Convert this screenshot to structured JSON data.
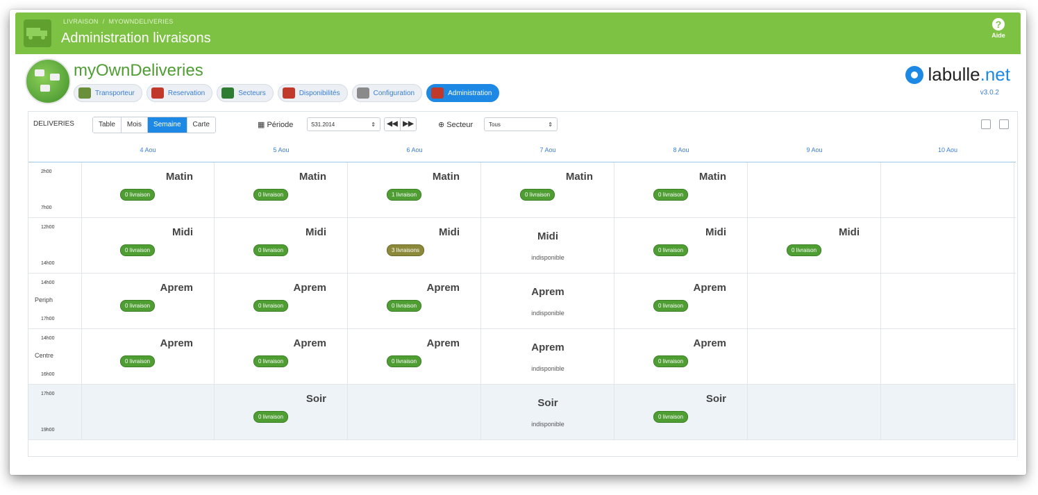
{
  "header": {
    "breadcrumb": [
      "LIVRAISON",
      "MYOWNDELIVERIES"
    ],
    "breadcrumb_sep": "/",
    "title": "Administration livraisons",
    "help_label": "Aide"
  },
  "brand": {
    "name": "myOwnDeliveries",
    "partner_logo": {
      "left": "labulle",
      "right": ".net"
    },
    "version": "v3.0.2"
  },
  "nav": [
    {
      "label": "Transporteur",
      "icon": "truck-icon",
      "color": "#6b8e3a"
    },
    {
      "label": "Reservation",
      "icon": "calendar-icon",
      "color": "#c0392b"
    },
    {
      "label": "Secteurs",
      "icon": "globe-icon",
      "color": "#2e7d32"
    },
    {
      "label": "Disponibilités",
      "icon": "calendar-x-icon",
      "color": "#c0392b"
    },
    {
      "label": "Configuration",
      "icon": "gear-icon",
      "color": "#8a8a8a"
    },
    {
      "label": "Administration",
      "icon": "calendar-icon",
      "color": "#c0392b",
      "active": true
    }
  ],
  "toolbar": {
    "section_label": "DELIVERIES",
    "views": [
      {
        "label": "Table",
        "active": false
      },
      {
        "label": "Mois",
        "active": false
      },
      {
        "label": "Semaine",
        "active": true
      },
      {
        "label": "Carte",
        "active": false
      }
    ],
    "periode_label": "Période",
    "periode_value": "S31.2014",
    "prev_label": "◀◀",
    "next_label": "▶▶",
    "secteur_label": "Secteur",
    "secteur_value": "Tous"
  },
  "days": [
    "4 Aou",
    "5 Aou",
    "6 Aou",
    "7 Aou",
    "8 Aou",
    "9 Aou",
    "10 Aou"
  ],
  "rows": [
    {
      "start": "2h00",
      "end": "7h00",
      "sub": "",
      "soir": false,
      "cells": [
        {
          "slot": "Matin",
          "badge": "0 livraison"
        },
        {
          "slot": "Matin",
          "badge": "0 livraison"
        },
        {
          "slot": "Matin",
          "badge": "1 livraison"
        },
        {
          "slot": "Matin",
          "badge": "0 livraison"
        },
        {
          "slot": "Matin",
          "badge": "0 livraison"
        },
        null,
        null
      ]
    },
    {
      "start": "12h00",
      "end": "14h00",
      "sub": "",
      "soir": false,
      "cells": [
        {
          "slot": "Midi",
          "badge": "0 livraison"
        },
        {
          "slot": "Midi",
          "badge": "0 livraison"
        },
        {
          "slot": "Midi",
          "badge": "3 livraisons",
          "multi": true
        },
        {
          "slot": "Midi",
          "unavailable": "indisponible"
        },
        {
          "slot": "Midi",
          "badge": "0 livraison"
        },
        {
          "slot": "Midi",
          "badge": "0 livraison"
        },
        null
      ]
    },
    {
      "start": "14h00",
      "end": "17h00",
      "sub": "Periph",
      "soir": false,
      "cells": [
        {
          "slot": "Aprem",
          "badge": "0 livraison"
        },
        {
          "slot": "Aprem",
          "badge": "0 livraison"
        },
        {
          "slot": "Aprem",
          "badge": "0 livraison"
        },
        {
          "slot": "Aprem",
          "unavailable": "indisponible"
        },
        {
          "slot": "Aprem",
          "badge": "0 livraison"
        },
        null,
        null
      ]
    },
    {
      "start": "14h00",
      "end": "16h00",
      "sub": "Centre",
      "soir": false,
      "cells": [
        {
          "slot": "Aprem",
          "badge": "0 livraison"
        },
        {
          "slot": "Aprem",
          "badge": "0 livraison"
        },
        {
          "slot": "Aprem",
          "badge": "0 livraison"
        },
        {
          "slot": "Aprem",
          "unavailable": "indisponible"
        },
        {
          "slot": "Aprem",
          "badge": "0 livraison"
        },
        null,
        null
      ]
    },
    {
      "start": "17h00",
      "end": "19h00",
      "sub": "",
      "soir": true,
      "cells": [
        null,
        {
          "slot": "Soir",
          "badge": "0 livraison"
        },
        null,
        {
          "slot": "Soir",
          "unavailable": "indisponible"
        },
        {
          "slot": "Soir",
          "badge": "0 livraison"
        },
        null,
        null
      ]
    }
  ]
}
